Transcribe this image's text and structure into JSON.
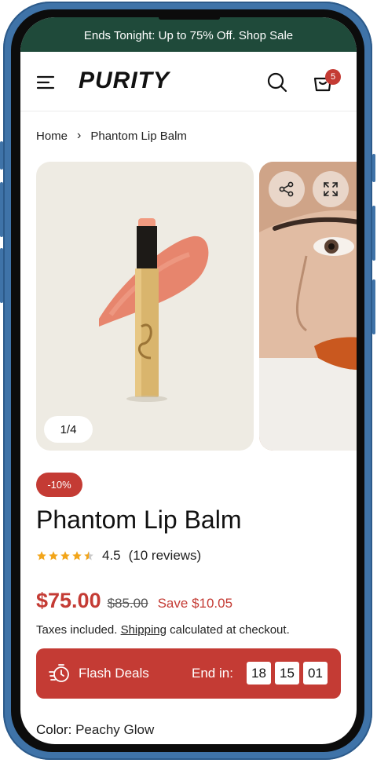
{
  "announcement": "Ends Tonight: Up to 75% Off. Shop Sale",
  "header": {
    "logo": "PURITY",
    "cart_count": "5",
    "icons": [
      "menu-icon",
      "search-icon",
      "cart-icon"
    ]
  },
  "breadcrumb": {
    "home": "Home",
    "separator": "›",
    "current": "Phantom Lip Balm"
  },
  "gallery": {
    "counter": "1/4",
    "actions": [
      "share-icon",
      "expand-icon"
    ]
  },
  "product": {
    "discount_badge": "-10%",
    "title": "Phantom Lip Balm",
    "rating": "4.5",
    "rating_value": 4.5,
    "reviews": "(10 reviews)",
    "price": "$75.00",
    "compare_price": "$85.00",
    "save": "Save $10.05",
    "tax_prefix": "Taxes included.",
    "tax_link": "Shipping",
    "tax_suffix": "calculated at checkout."
  },
  "flash_deals": {
    "label": "Flash Deals",
    "end_label": "End in:",
    "hours": "18",
    "minutes": "15",
    "seconds": "01"
  },
  "variant": {
    "label": "Color:",
    "value": "Peachy Glow"
  },
  "colors": {
    "announce_bg": "#1f4a3a",
    "accent": "#c43b34",
    "frame": "#3f73a8",
    "star": "#f2a51a"
  }
}
